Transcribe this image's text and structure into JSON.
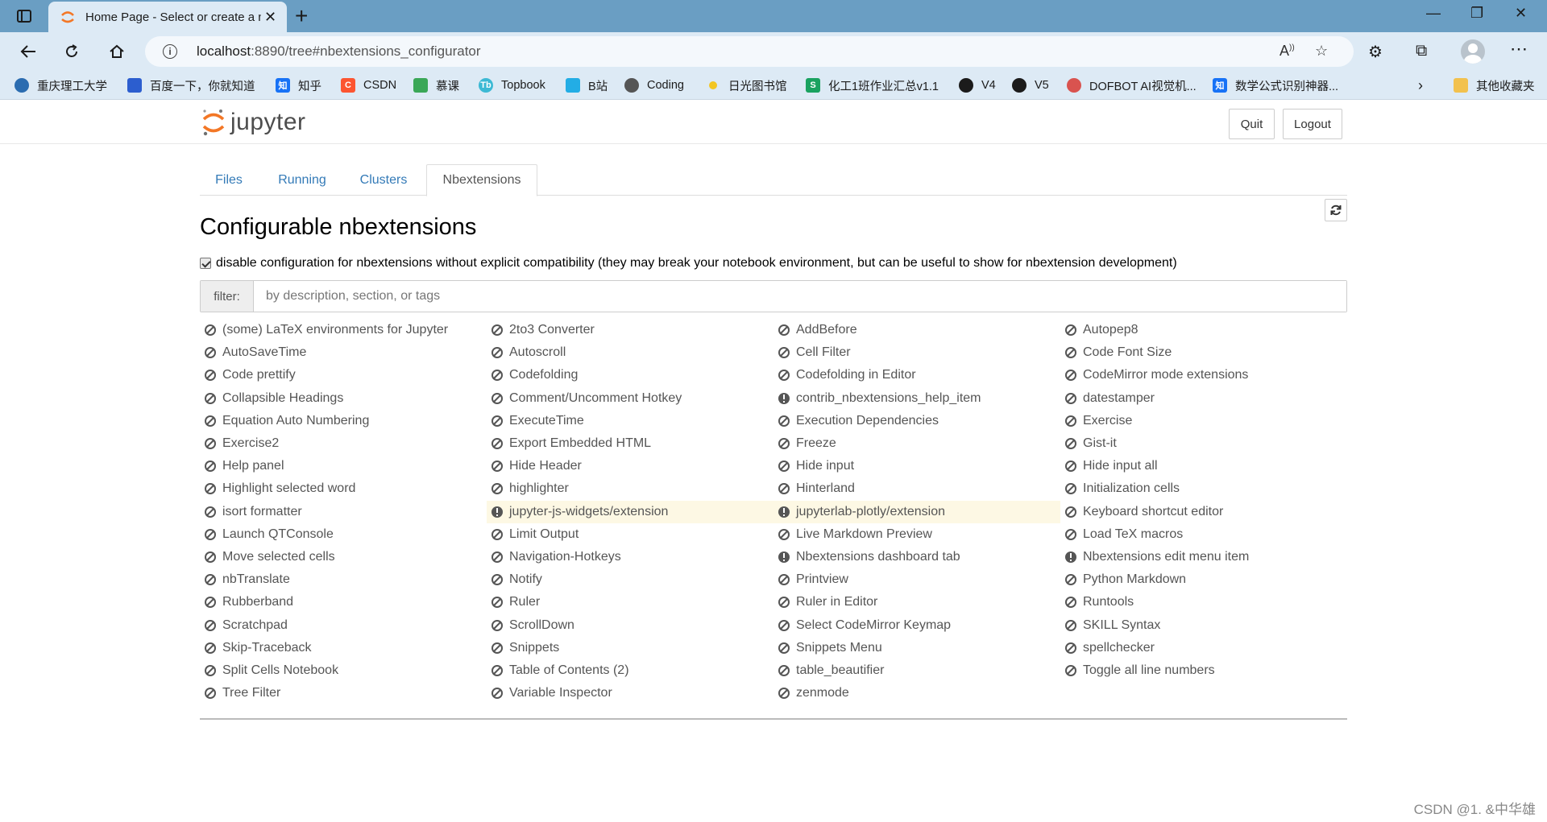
{
  "browser": {
    "tab_title": "Home Page - Select or create a n",
    "url_host": "localhost",
    "url_rest": ":8890/tree#nbextensions_configurator",
    "bookmarks": [
      {
        "label": "重庆理工大学",
        "color": "#2b6cb0"
      },
      {
        "label": "百度一下，你就知道",
        "color": "#2c5ecf"
      },
      {
        "label": "知乎",
        "color": "#1772f6"
      },
      {
        "label": "CSDN",
        "color": "#fc5531"
      },
      {
        "label": "慕课",
        "color": "#3aa757"
      },
      {
        "label": "Topbook",
        "color": "#3cb9d4"
      },
      {
        "label": "B站",
        "color": "#23ade5"
      },
      {
        "label": "Coding",
        "color": "#555555"
      },
      {
        "label": "日光图书馆",
        "color": "#f3c623"
      },
      {
        "label": "化工1班作业汇总v1.1",
        "color": "#1aa260"
      },
      {
        "label": "V4",
        "color": "#1b1b1b"
      },
      {
        "label": "V5",
        "color": "#1b1b1b"
      },
      {
        "label": "DOFBOT AI视觉机...",
        "color": "#d9534f"
      },
      {
        "label": "数学公式识别神器...",
        "color": "#1772f6"
      },
      {
        "label": "其他收藏夹",
        "color": "#f2c14e"
      }
    ]
  },
  "jupyter": {
    "logo_text": "jupyter",
    "quit_label": "Quit",
    "logout_label": "Logout",
    "tabs": [
      "Files",
      "Running",
      "Clusters",
      "Nbextensions"
    ],
    "heading": "Configurable nbextensions",
    "compat_label": "disable configuration for nbextensions without explicit compatibility (they may break your notebook environment, but can be useful to show for nbextension development)",
    "filter_label": "filter:",
    "filter_placeholder": "by description, section, or tags",
    "extensions": [
      {
        "name": "(some) LaTeX environments for Jupyter",
        "status": "disabled"
      },
      {
        "name": "2to3 Converter",
        "status": "disabled"
      },
      {
        "name": "AddBefore",
        "status": "disabled"
      },
      {
        "name": "Autopep8",
        "status": "disabled"
      },
      {
        "name": "AutoSaveTime",
        "status": "disabled"
      },
      {
        "name": "Autoscroll",
        "status": "disabled"
      },
      {
        "name": "Cell Filter",
        "status": "disabled"
      },
      {
        "name": "Code Font Size",
        "status": "disabled"
      },
      {
        "name": "Code prettify",
        "status": "disabled"
      },
      {
        "name": "Codefolding",
        "status": "disabled"
      },
      {
        "name": "Codefolding in Editor",
        "status": "disabled"
      },
      {
        "name": "CodeMirror mode extensions",
        "status": "disabled"
      },
      {
        "name": "Collapsible Headings",
        "status": "disabled"
      },
      {
        "name": "Comment/Uncomment Hotkey",
        "status": "disabled"
      },
      {
        "name": "contrib_nbextensions_help_item",
        "status": "info"
      },
      {
        "name": "datestamper",
        "status": "disabled"
      },
      {
        "name": "Equation Auto Numbering",
        "status": "disabled"
      },
      {
        "name": "ExecuteTime",
        "status": "disabled"
      },
      {
        "name": "Execution Dependencies",
        "status": "disabled"
      },
      {
        "name": "Exercise",
        "status": "disabled"
      },
      {
        "name": "Exercise2",
        "status": "disabled"
      },
      {
        "name": "Export Embedded HTML",
        "status": "disabled"
      },
      {
        "name": "Freeze",
        "status": "disabled"
      },
      {
        "name": "Gist-it",
        "status": "disabled"
      },
      {
        "name": "Help panel",
        "status": "disabled"
      },
      {
        "name": "Hide Header",
        "status": "disabled"
      },
      {
        "name": "Hide input",
        "status": "disabled"
      },
      {
        "name": "Hide input all",
        "status": "disabled"
      },
      {
        "name": "Highlight selected word",
        "status": "disabled"
      },
      {
        "name": "highlighter",
        "status": "disabled"
      },
      {
        "name": "Hinterland",
        "status": "disabled"
      },
      {
        "name": "Initialization cells",
        "status": "disabled"
      },
      {
        "name": "isort formatter",
        "status": "disabled"
      },
      {
        "name": "jupyter-js-widgets/extension",
        "status": "warning"
      },
      {
        "name": "jupyterlab-plotly/extension",
        "status": "warning"
      },
      {
        "name": "Keyboard shortcut editor",
        "status": "disabled"
      },
      {
        "name": "Launch QTConsole",
        "status": "disabled"
      },
      {
        "name": "Limit Output",
        "status": "disabled"
      },
      {
        "name": "Live Markdown Preview",
        "status": "disabled"
      },
      {
        "name": "Load TeX macros",
        "status": "disabled"
      },
      {
        "name": "Move selected cells",
        "status": "disabled"
      },
      {
        "name": "Navigation-Hotkeys",
        "status": "disabled"
      },
      {
        "name": "Nbextensions dashboard tab",
        "status": "info"
      },
      {
        "name": "Nbextensions edit menu item",
        "status": "info"
      },
      {
        "name": "nbTranslate",
        "status": "disabled"
      },
      {
        "name": "Notify",
        "status": "disabled"
      },
      {
        "name": "Printview",
        "status": "disabled"
      },
      {
        "name": "Python Markdown",
        "status": "disabled"
      },
      {
        "name": "Rubberband",
        "status": "disabled"
      },
      {
        "name": "Ruler",
        "status": "disabled"
      },
      {
        "name": "Ruler in Editor",
        "status": "disabled"
      },
      {
        "name": "Runtools",
        "status": "disabled"
      },
      {
        "name": "Scratchpad",
        "status": "disabled"
      },
      {
        "name": "ScrollDown",
        "status": "disabled"
      },
      {
        "name": "Select CodeMirror Keymap",
        "status": "disabled"
      },
      {
        "name": "SKILL Syntax",
        "status": "disabled"
      },
      {
        "name": "Skip-Traceback",
        "status": "disabled"
      },
      {
        "name": "Snippets",
        "status": "disabled"
      },
      {
        "name": "Snippets Menu",
        "status": "disabled"
      },
      {
        "name": "spellchecker",
        "status": "disabled"
      },
      {
        "name": "Split Cells Notebook",
        "status": "disabled"
      },
      {
        "name": "Table of Contents (2)",
        "status": "disabled"
      },
      {
        "name": "table_beautifier",
        "status": "disabled"
      },
      {
        "name": "Toggle all line numbers",
        "status": "disabled"
      },
      {
        "name": "Tree Filter",
        "status": "disabled"
      },
      {
        "name": "Variable Inspector",
        "status": "disabled"
      },
      {
        "name": "zenmode",
        "status": "disabled"
      }
    ]
  },
  "watermark": "CSDN @1. &中华雄",
  "colors": {
    "titlebar": "#6a9ec3",
    "chrome": "#ddeaf5",
    "link": "#337ab7",
    "warning_row": "#fdf8e4",
    "jupyter_orange": "#f37726"
  }
}
